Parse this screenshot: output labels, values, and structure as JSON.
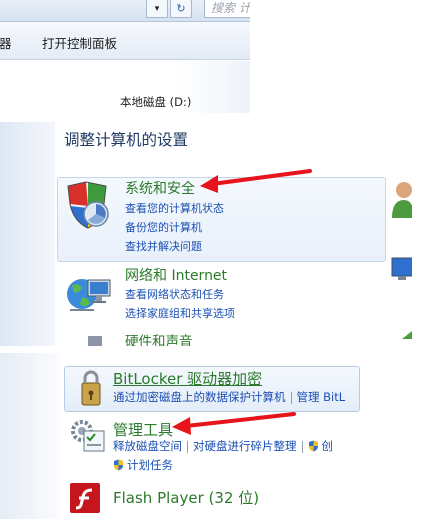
{
  "explorer": {
    "dropdown_glyph": "▾",
    "refresh_glyph": "↻",
    "search_placeholder": "搜索 计",
    "toolbar_partial": "器",
    "toolbar_item": "打开控制面板",
    "drive_label": "本地磁盘 (D:)"
  },
  "control_panel": {
    "heading": "调整计算机的设置",
    "categories": [
      {
        "title": "系统和安全",
        "icon": "shield-icon",
        "links": [
          "查看您的计算机状态",
          "备份您的计算机",
          "查找并解决问题"
        ]
      },
      {
        "title": "网络和 Internet",
        "icon": "network-globe-icon",
        "links": [
          "查看网络状态和任务",
          "选择家庭组和共享选项"
        ]
      },
      {
        "title": "硬件和声音",
        "icon": "hardware-icon"
      }
    ]
  },
  "admin": {
    "bitlocker": {
      "title": "BitLocker 驱动器加密",
      "links": [
        "通过加密磁盘上的数据保护计算机",
        "管理 BitL"
      ]
    },
    "admin_tools": {
      "title": "管理工具",
      "links": [
        "释放磁盘空间",
        "对硬盘进行碎片整理",
        "创"
      ],
      "link_row2": "计划任务"
    },
    "flash": {
      "title": "Flash Player (32 位)"
    }
  },
  "colors": {
    "category_title": "#2a7a2a",
    "link": "#1a4fb3",
    "highlight_box": "#e8f0fa",
    "arrow": "#e8141c"
  }
}
